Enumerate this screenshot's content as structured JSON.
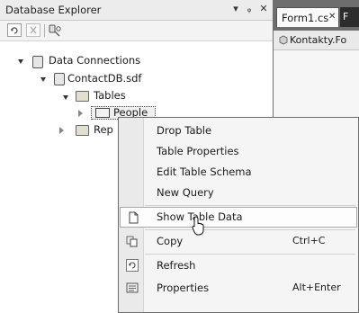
{
  "explorer": {
    "title": "Database Explorer",
    "header_buttons": [
      "▾",
      "ᵩ",
      "✕"
    ]
  },
  "tree": {
    "data_connections": "Data Connections",
    "db_file": "ContactDB.sdf",
    "tables": "Tables",
    "people": "People",
    "replication": "Rep"
  },
  "editor": {
    "tab_active": "Form1.cs",
    "tab_close": "✕",
    "tab_next": "F",
    "breadcrumb": "Kontakty.Fo"
  },
  "context_menu": {
    "items": [
      {
        "label": "Drop Table",
        "shortcut": ""
      },
      {
        "label": "Table Properties",
        "shortcut": ""
      },
      {
        "label": "Edit Table Schema",
        "shortcut": ""
      },
      {
        "label": "New Query",
        "shortcut": ""
      },
      {
        "label": "Show Table Data",
        "shortcut": ""
      },
      {
        "label": "Copy",
        "shortcut": "Ctrl+C"
      },
      {
        "label": "Refresh",
        "shortcut": ""
      },
      {
        "label": "Properties",
        "shortcut": "Alt+Enter"
      }
    ]
  }
}
